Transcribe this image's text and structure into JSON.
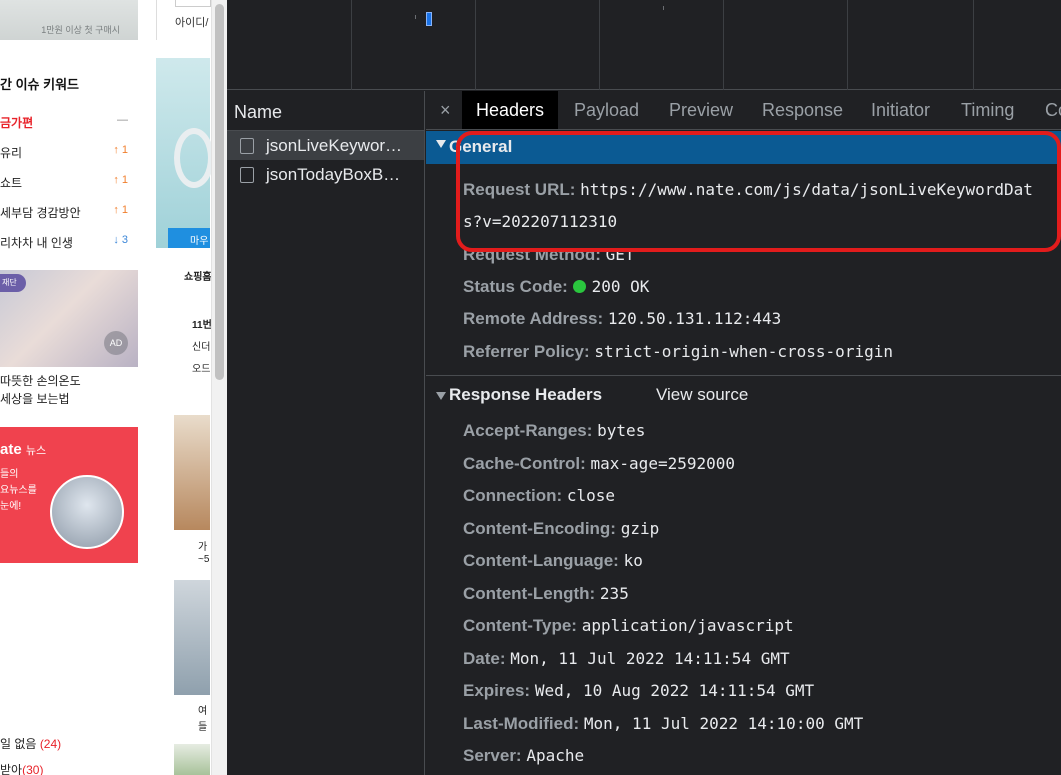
{
  "site": {
    "banner_caption": "1만원 이상 첫 구매시",
    "login_text": "아이디/",
    "keywords_title": "간 이슈 키워드",
    "keywords": [
      {
        "text": "금가편",
        "change": "—",
        "dir": "same"
      },
      {
        "text": "유리",
        "change": "↑ 1",
        "dir": "up"
      },
      {
        "text": "쇼트",
        "change": "↑ 1",
        "dir": "up"
      },
      {
        "text": "세부담 경감방안",
        "change": "↑ 1",
        "dir": "up"
      },
      {
        "text": "리차차 내 인생",
        "change": "↓ 3",
        "dir": "down"
      }
    ],
    "ad_logo": "재단",
    "ad_badge": "AD",
    "ad_caption_1": "따뜻한 손의온도",
    "ad_caption_2": "세상을 보는법",
    "nate_title": "ate",
    "nate_title_sub": "뉴스",
    "nate_desc_1": "들의",
    "nate_desc_2": "요뉴스를",
    "nate_desc_3": "눈에!",
    "bottom_link_1": "일 없음",
    "bottom_link_1_count": "(24)",
    "bottom_link_2": "받아",
    "bottom_link_2_count": "(30)",
    "shop_banner_label": "마우",
    "shop_label": "쇼핑홈",
    "shop_item_1": "11번",
    "shop_item_2": "신더",
    "shop_item_3": "오드",
    "thumb_caption_1a": "가",
    "thumb_caption_1b": "~5",
    "thumb_caption_2a": "여",
    "thumb_caption_2b": "들"
  },
  "devtools": {
    "name_header": "Name",
    "requests": [
      {
        "name": "jsonLiveKeywor…",
        "selected": true
      },
      {
        "name": "jsonTodayBoxB…",
        "selected": false
      }
    ],
    "tabs": {
      "close": "×",
      "headers": "Headers",
      "payload": "Payload",
      "preview": "Preview",
      "response": "Response",
      "initiator": "Initiator",
      "timing": "Timing",
      "cookies": "Co"
    },
    "general": {
      "title": "General",
      "request_url_key": "Request URL:",
      "request_url_1": "https://www.nate.com/js/data/jsonLiveKeywordDat",
      "request_url_2": "s?v=202207112310",
      "request_method_key": "Request Method:",
      "request_method": "GET",
      "status_code_key": "Status Code:",
      "status_code": "200 OK",
      "remote_address_key": "Remote Address:",
      "remote_address": "120.50.131.112:443",
      "referrer_policy_key": "Referrer Policy:",
      "referrer_policy": "strict-origin-when-cross-origin"
    },
    "response_headers": {
      "title": "Response Headers",
      "view_source": "View source",
      "items": [
        {
          "key": "Accept-Ranges:",
          "value": "bytes"
        },
        {
          "key": "Cache-Control:",
          "value": "max-age=2592000"
        },
        {
          "key": "Connection:",
          "value": "close"
        },
        {
          "key": "Content-Encoding:",
          "value": "gzip"
        },
        {
          "key": "Content-Language:",
          "value": "ko"
        },
        {
          "key": "Content-Length:",
          "value": "235"
        },
        {
          "key": "Content-Type:",
          "value": "application/javascript"
        },
        {
          "key": "Date:",
          "value": "Mon, 11 Jul 2022 14:11:54 GMT"
        },
        {
          "key": "Expires:",
          "value": "Wed, 10 Aug 2022 14:11:54 GMT"
        },
        {
          "key": "Last-Modified:",
          "value": "Mon, 11 Jul 2022 14:10:00 GMT"
        },
        {
          "key": "Server:",
          "value": "Apache"
        }
      ]
    }
  },
  "colors": {
    "devtools_bg": "#202124",
    "general_header": "#0b5a93",
    "highlight": "#e21c1c",
    "status_ok": "#2ac63e",
    "keyword_accent": "#e8232a"
  }
}
